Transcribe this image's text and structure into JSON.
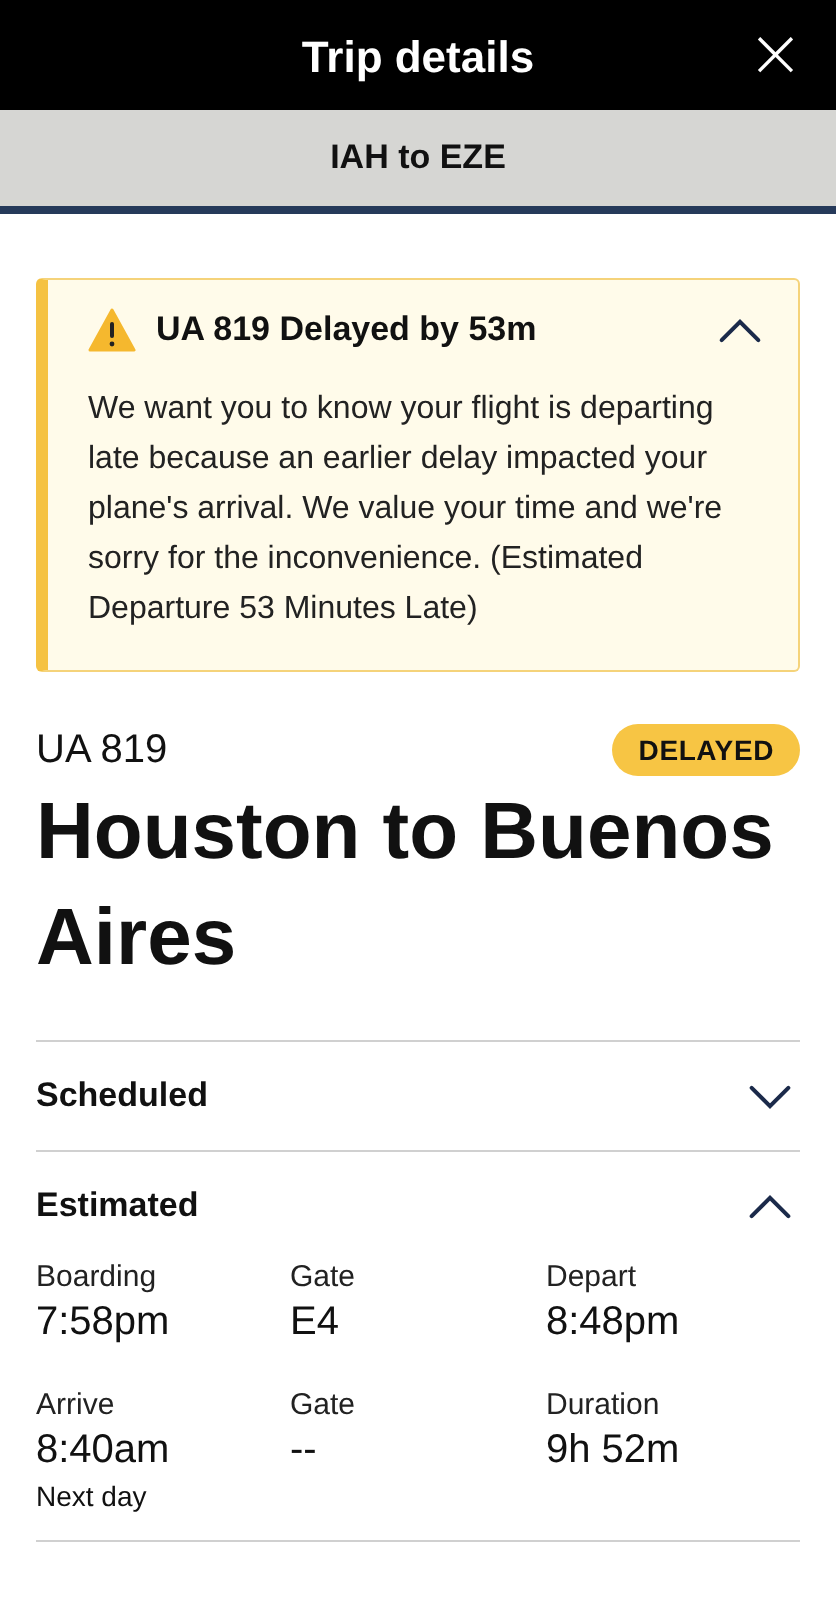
{
  "header": {
    "title": "Trip details",
    "close_icon": "×"
  },
  "route_bar": {
    "label": "IAH to EZE"
  },
  "alert": {
    "title": "UA 819 Delayed by 53m",
    "expanded": true,
    "message": "We want you to know your flight is departing late because an earlier delay impacted your plane's arrival. We value your time and we're sorry for the inconvenience. (Estimated Departure 53 Minutes Late)"
  },
  "flight": {
    "number": "UA 819",
    "status": "DELAYED",
    "title": "Houston to Buenos Aires"
  },
  "sections": [
    {
      "label": "Scheduled",
      "expanded": false
    },
    {
      "label": "Estimated",
      "expanded": true,
      "fields": [
        {
          "label": "Boarding",
          "value": "7:58pm"
        },
        {
          "label": "Gate",
          "value": "E4"
        },
        {
          "label": "Depart",
          "value": "8:48pm"
        },
        {
          "label": "Arrive",
          "value": "8:40am",
          "note": "Next day"
        },
        {
          "label": "Gate",
          "value": "--"
        },
        {
          "label": "Duration",
          "value": "9h 52m"
        }
      ]
    }
  ]
}
